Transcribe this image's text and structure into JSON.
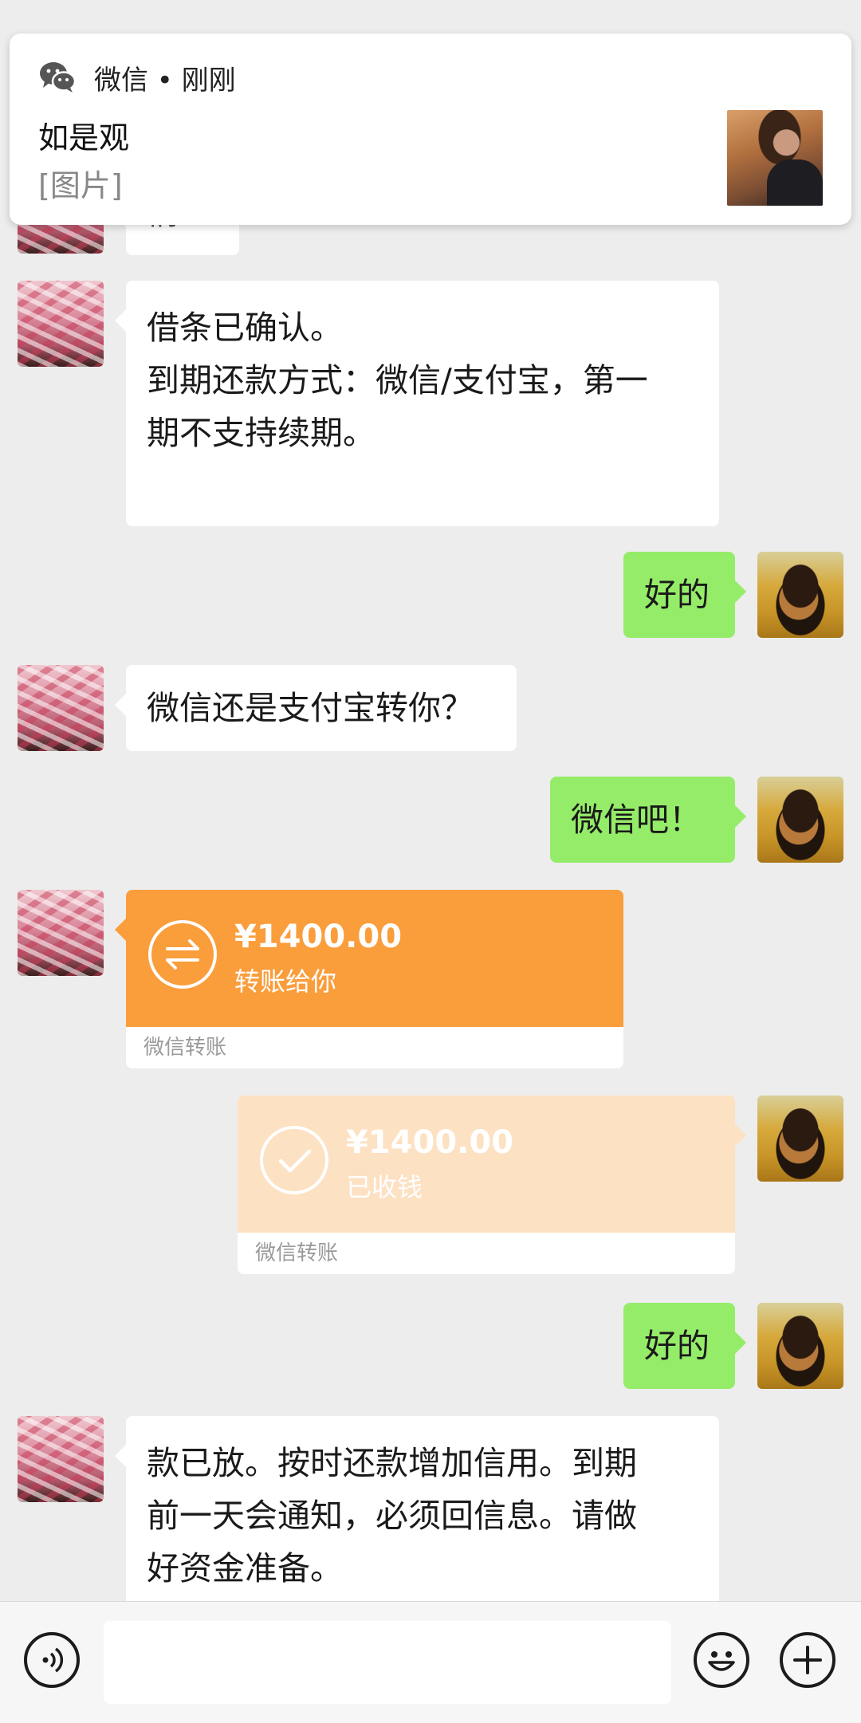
{
  "notification": {
    "app_label": "微信 • 刚刚",
    "sender": "如是观",
    "preview": "[图片]"
  },
  "messages": {
    "partial_top_text": "情…",
    "loan_confirm": {
      "line1": "借条已确认。",
      "line2": "到期还款方式：微信/支付宝，第一",
      "line3": "期不支持续期。"
    },
    "reply_ok_1": "好的",
    "ask_method": "微信还是支付宝转你？",
    "reply_wechat": "微信吧！",
    "transfer_sent": {
      "amount": "¥1400.00",
      "status": "转账给你",
      "footer": "微信转账"
    },
    "transfer_received": {
      "amount": "¥1400.00",
      "status": "已收钱",
      "footer": "微信转账"
    },
    "reply_ok_2": "好的",
    "loan_released": {
      "line1": "款已放。按时还款增加信用。到期",
      "line2": "前一天会通知，必须回信息。请做",
      "line3": "好资金准备。"
    }
  },
  "input_bar": {
    "voice_icon": "voice-icon",
    "emoji_icon": "emoji-icon",
    "plus_icon": "plus-icon"
  },
  "colors": {
    "background": "#ededed",
    "bubble_self": "#95ec69",
    "bubble_other": "#ffffff",
    "transfer_pending": "#fa9d3b",
    "transfer_done": "#fde1c3"
  }
}
